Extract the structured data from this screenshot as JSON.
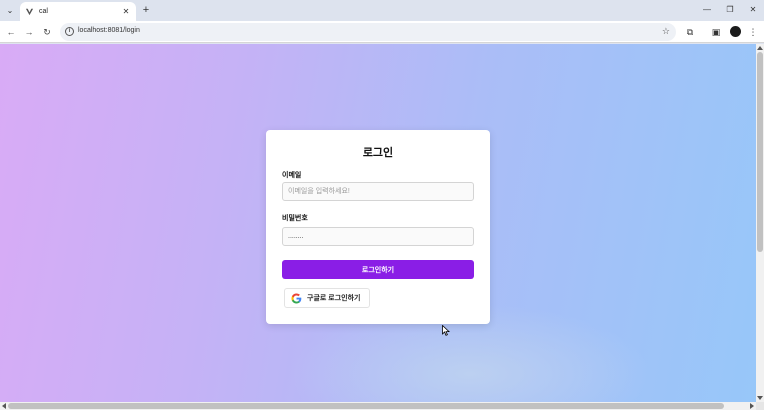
{
  "browser": {
    "tab_title": "cal",
    "url": "localhost:8081/login"
  },
  "login": {
    "title": "로그인",
    "email_label": "이메일",
    "email_placeholder": "이메일을 입력하세요!",
    "password_label": "비밀번호",
    "password_value": "........",
    "submit_label": "로그인하기",
    "google_label": "구글로 로그인하기"
  },
  "colors": {
    "accent": "#8a1ee6",
    "gradient_start": "#d9abf6",
    "gradient_end": "#97c7f9"
  }
}
